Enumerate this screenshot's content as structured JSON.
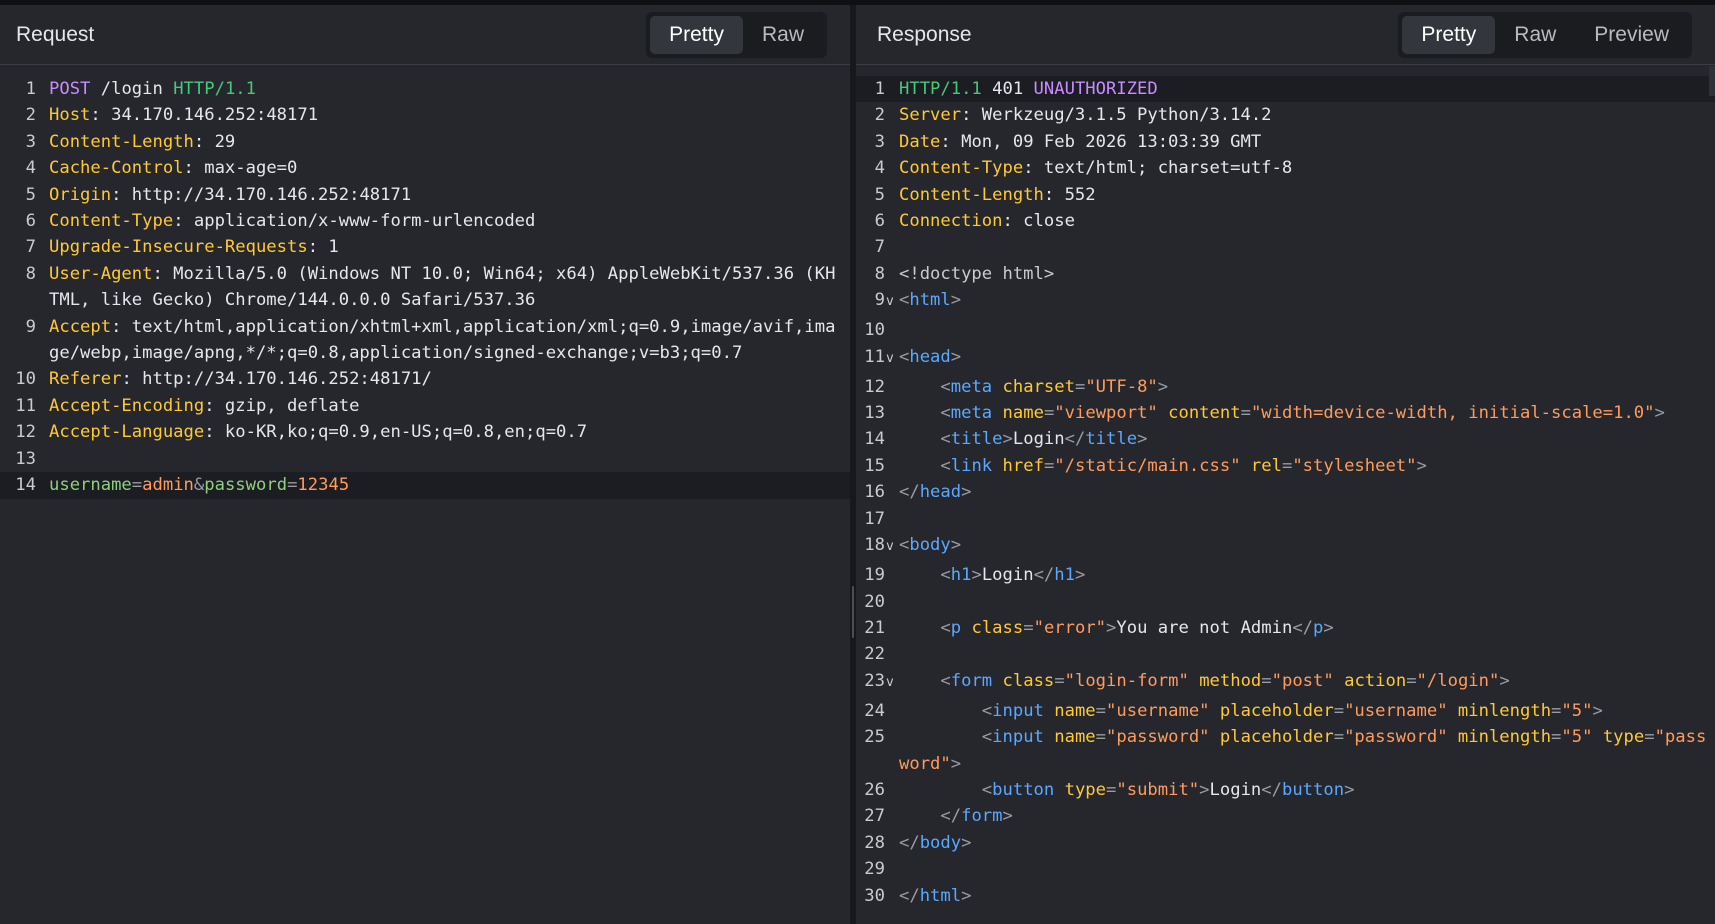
{
  "request": {
    "title": "Request",
    "tabs": [
      {
        "label": "Pretty",
        "active": true
      },
      {
        "label": "Raw",
        "active": false
      }
    ],
    "lines": [
      {
        "n": "1",
        "s": [
          {
            "t": "POST",
            "c": "mth"
          },
          {
            "t": " /login ",
            "c": ""
          },
          {
            "t": "HTTP/1.1",
            "c": "ver"
          }
        ]
      },
      {
        "n": "2",
        "s": [
          {
            "t": "Host",
            "c": "hk"
          },
          {
            "t": ": 34.170.146.252:48171",
            "c": ""
          }
        ]
      },
      {
        "n": "3",
        "s": [
          {
            "t": "Content-Length",
            "c": "hk"
          },
          {
            "t": ": 29",
            "c": ""
          }
        ]
      },
      {
        "n": "4",
        "s": [
          {
            "t": "Cache-Control",
            "c": "hk"
          },
          {
            "t": ": max-age=0",
            "c": ""
          }
        ]
      },
      {
        "n": "5",
        "s": [
          {
            "t": "Origin",
            "c": "hk"
          },
          {
            "t": ": http://34.170.146.252:48171",
            "c": ""
          }
        ]
      },
      {
        "n": "6",
        "s": [
          {
            "t": "Content-Type",
            "c": "hk"
          },
          {
            "t": ": application/x-www-form-urlencoded",
            "c": ""
          }
        ]
      },
      {
        "n": "7",
        "s": [
          {
            "t": "Upgrade-Insecure-Requests",
            "c": "hk"
          },
          {
            "t": ": 1",
            "c": ""
          }
        ]
      },
      {
        "n": "8",
        "s": [
          {
            "t": "User-Agent",
            "c": "hk"
          },
          {
            "t": ": Mozilla/5.0 (Windows NT 10.0; Win64; x64) AppleWebKit/537.36 (KHTML, like Gecko) Chrome/144.0.0.0 Safari/537.36",
            "c": ""
          }
        ]
      },
      {
        "n": "9",
        "s": [
          {
            "t": "Accept",
            "c": "hk"
          },
          {
            "t": ": text/html,application/xhtml+xml,application/xml;q=0.9,image/avif,image/webp,image/apng,*/*;q=0.8,application/signed-exchange;v=b3;q=0.7",
            "c": ""
          }
        ]
      },
      {
        "n": "10",
        "s": [
          {
            "t": "Referer",
            "c": "hk"
          },
          {
            "t": ": http://34.170.146.252:48171/",
            "c": ""
          }
        ]
      },
      {
        "n": "11",
        "s": [
          {
            "t": "Accept-Encoding",
            "c": "hk"
          },
          {
            "t": ": gzip, deflate",
            "c": ""
          }
        ]
      },
      {
        "n": "12",
        "s": [
          {
            "t": "Accept-Language",
            "c": "hk"
          },
          {
            "t": ": ko-KR,ko;q=0.9,en-US;q=0.8,en;q=0.7",
            "c": ""
          }
        ]
      },
      {
        "n": "13",
        "s": []
      },
      {
        "n": "14",
        "hl": true,
        "s": [
          {
            "t": "username",
            "c": "pk"
          },
          {
            "t": "=",
            "c": "pun"
          },
          {
            "t": "admin",
            "c": "pv"
          },
          {
            "t": "&",
            "c": "pun"
          },
          {
            "t": "password",
            "c": "pk"
          },
          {
            "t": "=",
            "c": "pun"
          },
          {
            "t": "12345",
            "c": "pv"
          }
        ]
      }
    ]
  },
  "response": {
    "title": "Response",
    "tabs": [
      {
        "label": "Pretty",
        "active": true
      },
      {
        "label": "Raw",
        "active": false
      },
      {
        "label": "Preview",
        "active": false
      }
    ],
    "lines": [
      {
        "n": "1",
        "hl": true,
        "s": [
          {
            "t": "HTTP/1.1",
            "c": "ver"
          },
          {
            "t": " 401 ",
            "c": ""
          },
          {
            "t": "UNAUTHORIZED",
            "c": "stat"
          }
        ]
      },
      {
        "n": "2",
        "s": [
          {
            "t": "Server",
            "c": "hk"
          },
          {
            "t": ": Werkzeug/3.1.5 Python/3.14.2",
            "c": ""
          }
        ]
      },
      {
        "n": "3",
        "s": [
          {
            "t": "Date",
            "c": "hk"
          },
          {
            "t": ": Mon, 09 Feb 2026 13:03:39 GMT",
            "c": ""
          }
        ]
      },
      {
        "n": "4",
        "s": [
          {
            "t": "Content-Type",
            "c": "hk"
          },
          {
            "t": ": text/html; charset=utf-8",
            "c": ""
          }
        ]
      },
      {
        "n": "5",
        "s": [
          {
            "t": "Content-Length",
            "c": "hk"
          },
          {
            "t": ": 552",
            "c": ""
          }
        ]
      },
      {
        "n": "6",
        "s": [
          {
            "t": "Connection",
            "c": "hk"
          },
          {
            "t": ": close",
            "c": ""
          }
        ]
      },
      {
        "n": "7",
        "s": []
      },
      {
        "n": "8",
        "s": [
          {
            "t": "<!doctype html>",
            "c": "cmt"
          }
        ]
      },
      {
        "n": "9",
        "fold": true,
        "s": [
          {
            "t": "<",
            "c": "pun"
          },
          {
            "t": "html",
            "c": "tag"
          },
          {
            "t": ">",
            "c": "pun"
          }
        ]
      },
      {
        "n": "10",
        "s": []
      },
      {
        "n": "11",
        "fold": true,
        "s": [
          {
            "t": "<",
            "c": "pun"
          },
          {
            "t": "head",
            "c": "tag"
          },
          {
            "t": ">",
            "c": "pun"
          }
        ]
      },
      {
        "n": "12",
        "s": [
          {
            "t": "    <",
            "c": "pun"
          },
          {
            "t": "meta",
            "c": "tag"
          },
          {
            "t": " ",
            "c": ""
          },
          {
            "t": "charset",
            "c": "att"
          },
          {
            "t": "=",
            "c": "pun"
          },
          {
            "t": "\"UTF-8\"",
            "c": "str"
          },
          {
            "t": ">",
            "c": "pun"
          }
        ]
      },
      {
        "n": "13",
        "s": [
          {
            "t": "    <",
            "c": "pun"
          },
          {
            "t": "meta",
            "c": "tag"
          },
          {
            "t": " ",
            "c": ""
          },
          {
            "t": "name",
            "c": "att"
          },
          {
            "t": "=",
            "c": "pun"
          },
          {
            "t": "\"viewport\"",
            "c": "str"
          },
          {
            "t": " ",
            "c": ""
          },
          {
            "t": "content",
            "c": "att"
          },
          {
            "t": "=",
            "c": "pun"
          },
          {
            "t": "\"width=device-width, initial-scale=1.0\"",
            "c": "str"
          },
          {
            "t": ">",
            "c": "pun"
          }
        ]
      },
      {
        "n": "14",
        "s": [
          {
            "t": "    <",
            "c": "pun"
          },
          {
            "t": "title",
            "c": "tag"
          },
          {
            "t": ">",
            "c": "pun"
          },
          {
            "t": "Login",
            "c": ""
          },
          {
            "t": "</",
            "c": "pun"
          },
          {
            "t": "title",
            "c": "tag"
          },
          {
            "t": ">",
            "c": "pun"
          }
        ]
      },
      {
        "n": "15",
        "s": [
          {
            "t": "    <",
            "c": "pun"
          },
          {
            "t": "link",
            "c": "tag"
          },
          {
            "t": " ",
            "c": ""
          },
          {
            "t": "href",
            "c": "att"
          },
          {
            "t": "=",
            "c": "pun"
          },
          {
            "t": "\"/static/main.css\"",
            "c": "str"
          },
          {
            "t": " ",
            "c": ""
          },
          {
            "t": "rel",
            "c": "att"
          },
          {
            "t": "=",
            "c": "pun"
          },
          {
            "t": "\"stylesheet\"",
            "c": "str"
          },
          {
            "t": ">",
            "c": "pun"
          }
        ]
      },
      {
        "n": "16",
        "s": [
          {
            "t": "</",
            "c": "pun"
          },
          {
            "t": "head",
            "c": "tag"
          },
          {
            "t": ">",
            "c": "pun"
          }
        ]
      },
      {
        "n": "17",
        "s": []
      },
      {
        "n": "18",
        "fold": true,
        "s": [
          {
            "t": "<",
            "c": "pun"
          },
          {
            "t": "body",
            "c": "tag"
          },
          {
            "t": ">",
            "c": "pun"
          }
        ]
      },
      {
        "n": "19",
        "s": [
          {
            "t": "    <",
            "c": "pun"
          },
          {
            "t": "h1",
            "c": "tag"
          },
          {
            "t": ">",
            "c": "pun"
          },
          {
            "t": "Login",
            "c": ""
          },
          {
            "t": "</",
            "c": "pun"
          },
          {
            "t": "h1",
            "c": "tag"
          },
          {
            "t": ">",
            "c": "pun"
          }
        ]
      },
      {
        "n": "20",
        "s": []
      },
      {
        "n": "21",
        "s": [
          {
            "t": "    <",
            "c": "pun"
          },
          {
            "t": "p",
            "c": "tag"
          },
          {
            "t": " ",
            "c": ""
          },
          {
            "t": "class",
            "c": "att"
          },
          {
            "t": "=",
            "c": "pun"
          },
          {
            "t": "\"error\"",
            "c": "str"
          },
          {
            "t": ">",
            "c": "pun"
          },
          {
            "t": "You are not Admin",
            "c": ""
          },
          {
            "t": "</",
            "c": "pun"
          },
          {
            "t": "p",
            "c": "tag"
          },
          {
            "t": ">",
            "c": "pun"
          }
        ]
      },
      {
        "n": "22",
        "s": []
      },
      {
        "n": "23",
        "fold": true,
        "s": [
          {
            "t": "    <",
            "c": "pun"
          },
          {
            "t": "form",
            "c": "tag"
          },
          {
            "t": " ",
            "c": ""
          },
          {
            "t": "class",
            "c": "att"
          },
          {
            "t": "=",
            "c": "pun"
          },
          {
            "t": "\"login-form\"",
            "c": "str"
          },
          {
            "t": " ",
            "c": ""
          },
          {
            "t": "method",
            "c": "att"
          },
          {
            "t": "=",
            "c": "pun"
          },
          {
            "t": "\"post\"",
            "c": "str"
          },
          {
            "t": " ",
            "c": ""
          },
          {
            "t": "action",
            "c": "att"
          },
          {
            "t": "=",
            "c": "pun"
          },
          {
            "t": "\"/login\"",
            "c": "str"
          },
          {
            "t": ">",
            "c": "pun"
          }
        ]
      },
      {
        "n": "24",
        "s": [
          {
            "t": "        <",
            "c": "pun"
          },
          {
            "t": "input",
            "c": "tag"
          },
          {
            "t": " ",
            "c": ""
          },
          {
            "t": "name",
            "c": "att"
          },
          {
            "t": "=",
            "c": "pun"
          },
          {
            "t": "\"username\"",
            "c": "str"
          },
          {
            "t": " ",
            "c": ""
          },
          {
            "t": "placeholder",
            "c": "att"
          },
          {
            "t": "=",
            "c": "pun"
          },
          {
            "t": "\"username\"",
            "c": "str"
          },
          {
            "t": " ",
            "c": ""
          },
          {
            "t": "minlength",
            "c": "att"
          },
          {
            "t": "=",
            "c": "pun"
          },
          {
            "t": "\"5\"",
            "c": "str"
          },
          {
            "t": ">",
            "c": "pun"
          }
        ]
      },
      {
        "n": "25",
        "s": [
          {
            "t": "        <",
            "c": "pun"
          },
          {
            "t": "input",
            "c": "tag"
          },
          {
            "t": " ",
            "c": ""
          },
          {
            "t": "name",
            "c": "att"
          },
          {
            "t": "=",
            "c": "pun"
          },
          {
            "t": "\"password\"",
            "c": "str"
          },
          {
            "t": " ",
            "c": ""
          },
          {
            "t": "placeholder",
            "c": "att"
          },
          {
            "t": "=",
            "c": "pun"
          },
          {
            "t": "\"password\"",
            "c": "str"
          },
          {
            "t": " ",
            "c": ""
          },
          {
            "t": "minlength",
            "c": "att"
          },
          {
            "t": "=",
            "c": "pun"
          },
          {
            "t": "\"5\"",
            "c": "str"
          },
          {
            "t": " ",
            "c": ""
          },
          {
            "t": "type",
            "c": "att"
          },
          {
            "t": "=",
            "c": "pun"
          },
          {
            "t": "\"password\"",
            "c": "str"
          },
          {
            "t": ">",
            "c": "pun"
          }
        ]
      },
      {
        "n": "26",
        "s": [
          {
            "t": "        <",
            "c": "pun"
          },
          {
            "t": "button",
            "c": "tag"
          },
          {
            "t": " ",
            "c": ""
          },
          {
            "t": "type",
            "c": "att"
          },
          {
            "t": "=",
            "c": "pun"
          },
          {
            "t": "\"submit\"",
            "c": "str"
          },
          {
            "t": ">",
            "c": "pun"
          },
          {
            "t": "Login",
            "c": ""
          },
          {
            "t": "</",
            "c": "pun"
          },
          {
            "t": "button",
            "c": "tag"
          },
          {
            "t": ">",
            "c": "pun"
          }
        ]
      },
      {
        "n": "27",
        "s": [
          {
            "t": "    </",
            "c": "pun"
          },
          {
            "t": "form",
            "c": "tag"
          },
          {
            "t": ">",
            "c": "pun"
          }
        ]
      },
      {
        "n": "28",
        "s": [
          {
            "t": "</",
            "c": "pun"
          },
          {
            "t": "body",
            "c": "tag"
          },
          {
            "t": ">",
            "c": "pun"
          }
        ]
      },
      {
        "n": "29",
        "s": []
      },
      {
        "n": "30",
        "s": [
          {
            "t": "</",
            "c": "pun"
          },
          {
            "t": "html",
            "c": "tag"
          },
          {
            "t": ">",
            "c": "pun"
          }
        ]
      }
    ]
  }
}
